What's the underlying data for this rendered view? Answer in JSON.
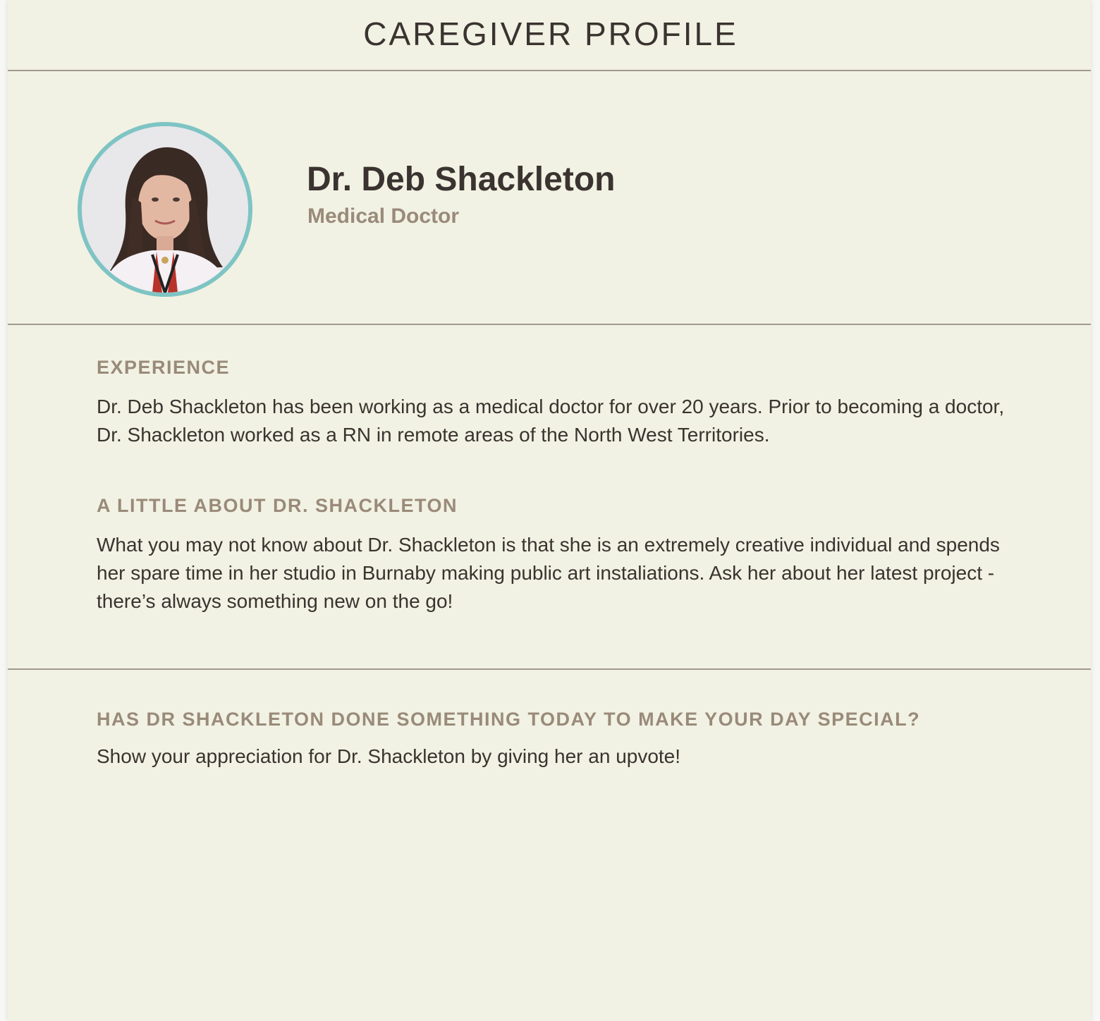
{
  "header": {
    "title": "CAREGIVER PROFILE"
  },
  "profile": {
    "name": "Dr. Deb Shackleton",
    "role": "Medical Doctor",
    "avatar_border_color": "#7fc4c4"
  },
  "experience": {
    "heading": "EXPERIENCE",
    "text": "Dr. Deb Shackleton has been working as a medical doctor for over 20 years. Prior to becoming a doctor, Dr. Shackleton worked as a RN in remote areas of the North West Territories."
  },
  "about": {
    "heading": "A LITTLE ABOUT DR. SHACKLETON",
    "text": "What you may not know about Dr. Shackleton is that she is an extremely creative individual and spends her spare time in her studio in Burnaby making public art instaliations.  Ask her about her latest project - there’s always something new on the go!"
  },
  "upvote": {
    "heading": "HAS DR SHACKLETON DONE SOMETHING TODAY TO MAKE YOUR DAY SPECIAL?",
    "text": "Show your appreciation for Dr. Shackleton by giving her an upvote!"
  },
  "colors": {
    "background": "#f1f2e3",
    "divider": "#a39a8e",
    "accent_text": "#9a8a7a",
    "body_text": "#3a3330"
  }
}
